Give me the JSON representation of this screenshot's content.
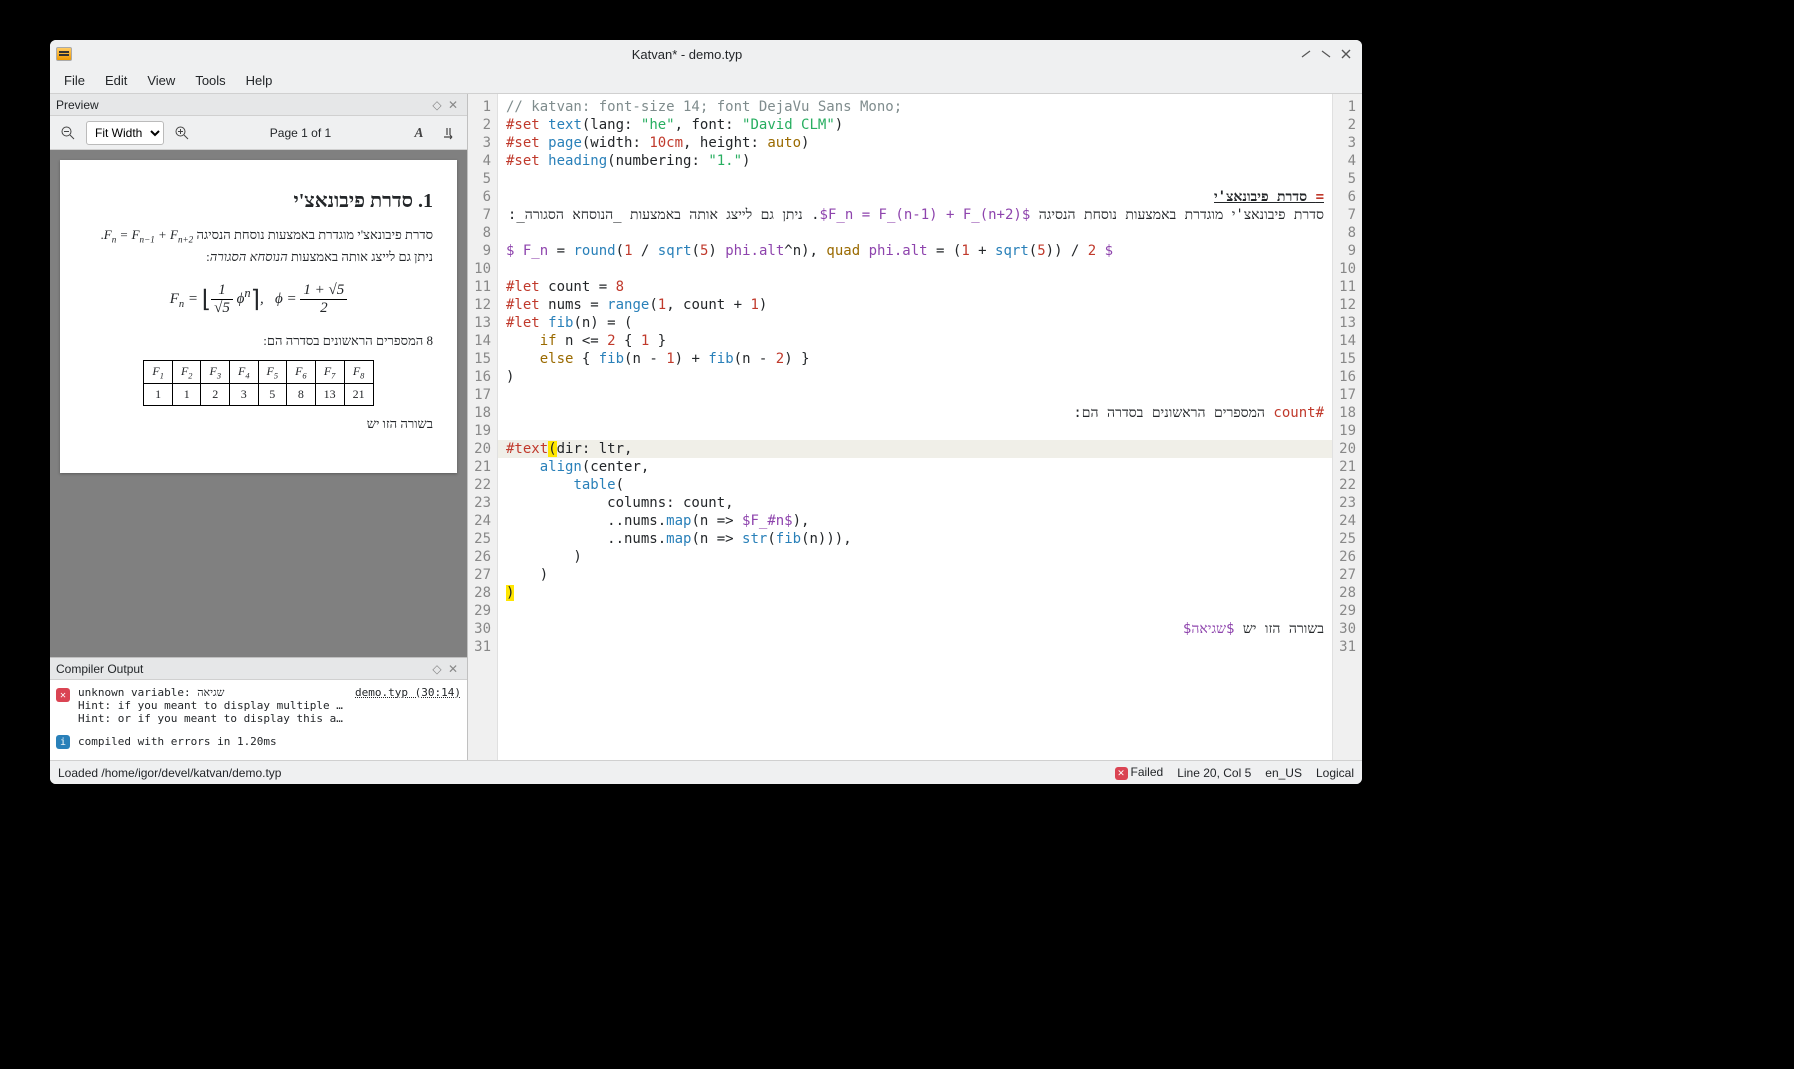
{
  "window": {
    "title": "Katvan* - demo.typ"
  },
  "menu": {
    "file": "File",
    "edit": "Edit",
    "view": "View",
    "tools": "Tools",
    "help": "Help"
  },
  "preview": {
    "panel_title": "Preview",
    "zoom_mode": "Fit Width",
    "page_info": "Page 1 of 1",
    "doc": {
      "heading": "1. סדרת פיבונאצ'י",
      "para1_a": "סדרת פיבונאצ'י מוגדרת באמצעות נוסחת הנסיגה ",
      "para1_b": ". ניתן גם לייצג אותה באמצעות ",
      "para1_c": "הנוסחא הסגורה",
      "para1_d": ":",
      "inline_math": "F<sub>n</sub> = F<sub>n−1</sub> + F<sub>n+2</sub>",
      "para2": "8 המספרים הראשונים בסדרה הם:",
      "para3": "בשורה הזו יש"
    }
  },
  "compiler": {
    "panel_title": "Compiler Output",
    "err_lines": "unknown variable: שגיאה\nHint: if you meant to display multiple let…\nHint: or if you meant to display this as t…",
    "err_loc": "demo.typ (30:14)",
    "info": "compiled with errors in 1.20ms"
  },
  "editor": {
    "line_count": 31,
    "current_line": 20
  },
  "status": {
    "loaded": "Loaded /home/igor/devel/katvan/demo.typ",
    "failed": "Failed",
    "cursor": "Line 20, Col 5",
    "locale": "en_US",
    "direction": "Logical"
  },
  "chart_data": {
    "type": "table",
    "headers": [
      "F₁",
      "F₂",
      "F₃",
      "F₄",
      "F₅",
      "F₆",
      "F₇",
      "F₈"
    ],
    "values": [
      1,
      1,
      2,
      3,
      5,
      8,
      13,
      21
    ]
  }
}
